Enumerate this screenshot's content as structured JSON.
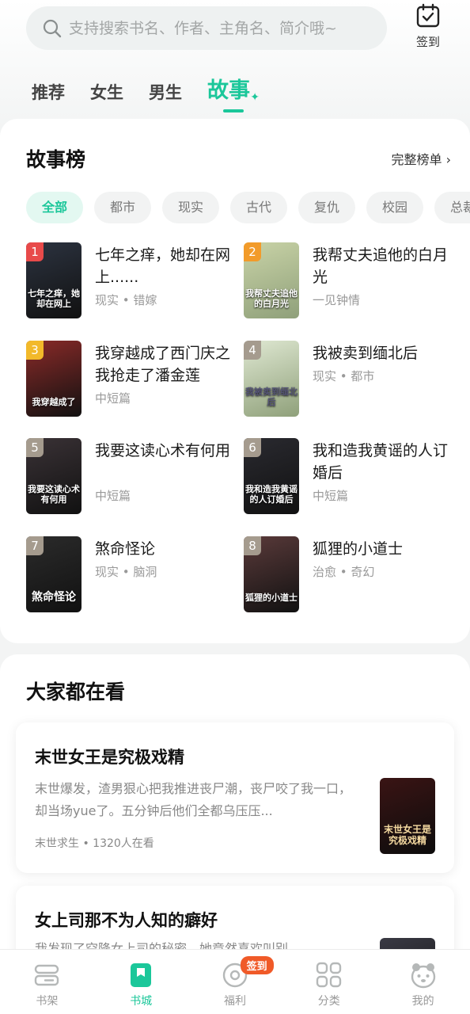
{
  "search": {
    "placeholder": "支持搜索书名、作者、主角名、简介哦~"
  },
  "checkin": {
    "label": "签到"
  },
  "tabs": [
    {
      "label": "推荐"
    },
    {
      "label": "女生"
    },
    {
      "label": "男生"
    },
    {
      "label": "故事"
    }
  ],
  "ranking": {
    "title": "故事榜",
    "more": "完整榜单 ›",
    "chips": [
      "全部",
      "都市",
      "现实",
      "古代",
      "复仇",
      "校园",
      "总裁"
    ],
    "items": [
      {
        "rank": "1",
        "title": "七年之痒，她却在网上......",
        "meta": "现实 • 错嫁",
        "cover_text": "七年之痒，她却在网上",
        "badge_color": "#e84a4a",
        "cover_color": "#2c3340"
      },
      {
        "rank": "2",
        "title": "我帮丈夫追他的白月光",
        "meta": "一见钟情",
        "cover_text": "我帮丈夫追他的白月光",
        "badge_color": "#f29b2a",
        "cover_color": "#c9d3a7"
      },
      {
        "rank": "3",
        "title": "我穿越成了西门庆之我抢走了潘金莲",
        "meta": "中短篇",
        "cover_text": "我穿越成了",
        "badge_color": "#f2b92a",
        "cover_color": "#8a2a28"
      },
      {
        "rank": "4",
        "title": "我被卖到缅北后",
        "meta": "现实 • 都市",
        "cover_text": "我被卖到缅北后",
        "badge_color": "#a59b8e",
        "cover_color": "#dfe8d2"
      },
      {
        "rank": "5",
        "title": "我要这读心术有何用",
        "meta": "中短篇",
        "cover_text": "我要这读心术有何用",
        "badge_color": "#a59b8e",
        "cover_color": "#3a3236"
      },
      {
        "rank": "6",
        "title": "我和造我黄谣的人订婚后",
        "meta": "中短篇",
        "cover_text": "我和造我黄谣的人订婚后",
        "badge_color": "#a59b8e",
        "cover_color": "#2a2a30"
      },
      {
        "rank": "7",
        "title": "煞命怪论",
        "meta": "现实 • 脑洞",
        "cover_text": "煞命怪论",
        "badge_color": "#a59b8e",
        "cover_color": "#2b2b2b"
      },
      {
        "rank": "8",
        "title": "狐狸的小道士",
        "meta": "治愈 • 奇幻",
        "cover_text": "狐狸的小道士",
        "badge_color": "#a59b8e",
        "cover_color": "#5a3a3a"
      }
    ]
  },
  "watching": {
    "title": "大家都在看",
    "items": [
      {
        "title": "末世女王是究极戏精",
        "desc": "末世爆发，渣男狠心把我推进丧尸潮，丧尸咬了我一口，却当场yue了。五分钟后他们全都乌压压...",
        "meta": "末世求生 • 1320人在看",
        "cover_text": "末世女王是究极戏精",
        "cover_color": "#3a1414"
      },
      {
        "title": "女上司那不为人知的癖好",
        "desc": "我发现了空降女上司的秘密，她竟然喜欢叫别...",
        "meta": "",
        "cover_text": "",
        "cover_color": "#3a3a44"
      }
    ]
  },
  "nav": [
    {
      "label": "书架",
      "icon": "bookshelf-icon"
    },
    {
      "label": "书城",
      "icon": "bookstore-icon"
    },
    {
      "label": "福利",
      "icon": "welfare-icon",
      "badge": "签到"
    },
    {
      "label": "分类",
      "icon": "category-icon"
    },
    {
      "label": "我的",
      "icon": "profile-icon"
    }
  ],
  "colors": {
    "accent": "#1bc79a",
    "badge": "#f05a28"
  }
}
